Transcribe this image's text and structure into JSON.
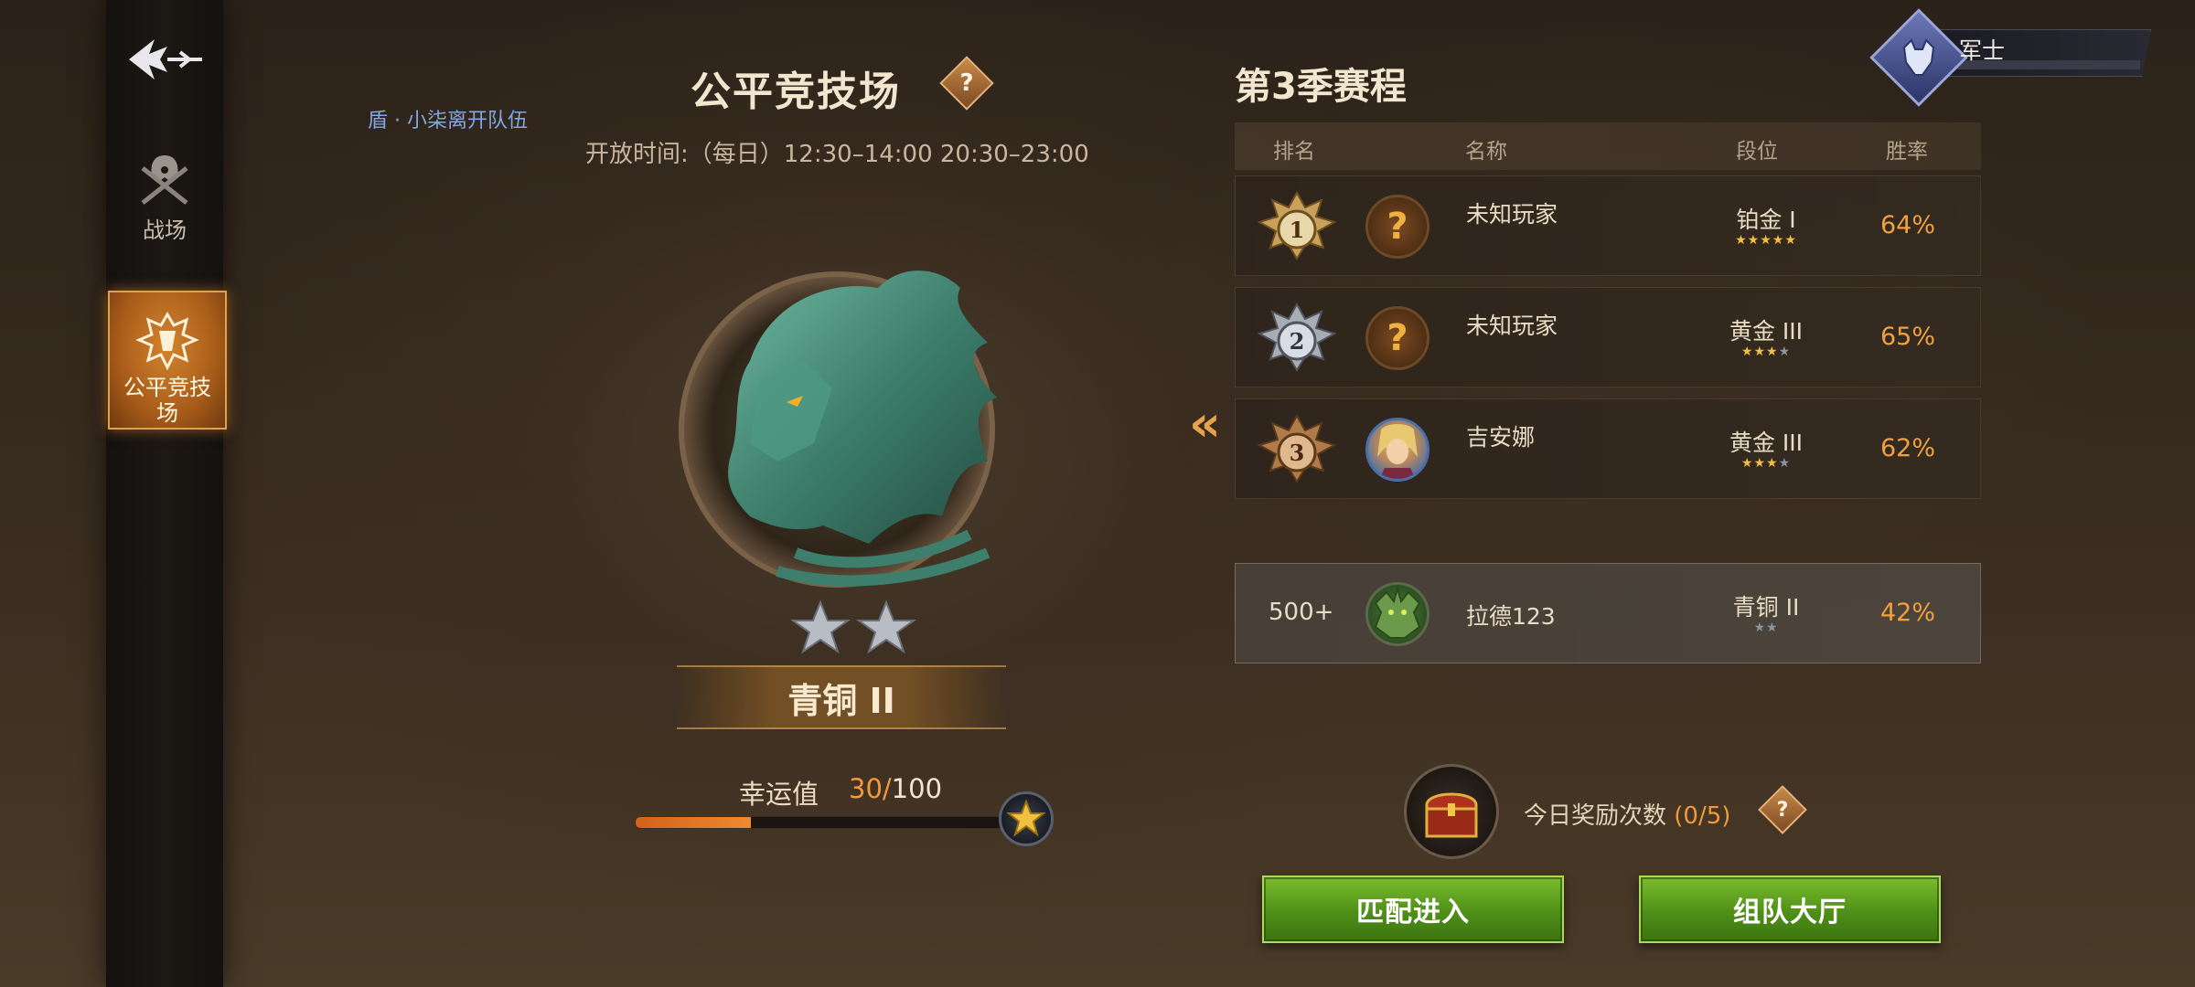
{
  "sidebar": {
    "items": [
      {
        "label": "战场",
        "icon": "crossed-swords-helmet-icon"
      },
      {
        "label": "公平竞技场",
        "icon": "arena-emblem-icon",
        "active": true
      }
    ]
  },
  "team_notice": "盾 · 小柒离开队伍",
  "arena": {
    "title": "公平竞技场",
    "open_time": "开放时间:（每日）12:30–14:00 20:30–23:00",
    "rank_name": "青铜 II",
    "stars": 2,
    "luck_label": "幸运值",
    "luck_current": "30/",
    "luck_max": "100",
    "luck_fraction": 0.3
  },
  "season": {
    "title": "第3季赛程",
    "headers": {
      "rank": "排名",
      "name": "名称",
      "tier": "段位",
      "winrate": "胜率"
    },
    "rows": [
      {
        "rank": "1",
        "name": "未知玩家",
        "tier": "铂金 I",
        "stars_on": 5,
        "stars_total": 5,
        "winrate": "64%"
      },
      {
        "rank": "2",
        "name": "未知玩家",
        "tier": "黄金 III",
        "stars_on": 3,
        "stars_total": 4,
        "winrate": "65%"
      },
      {
        "rank": "3",
        "name": "吉安娜",
        "tier": "黄金 III",
        "stars_on": 3,
        "stars_total": 4,
        "winrate": "62%"
      }
    ],
    "me": {
      "rank": "500+",
      "name": "拉德123",
      "tier": "青铜 II",
      "stars_on": 0,
      "stars_total": 2,
      "winrate": "42%"
    }
  },
  "reward": {
    "label": "今日奖励次数 ",
    "count": "(0/5)"
  },
  "buttons": {
    "match": "匹配进入",
    "team_hall": "组队大厅"
  },
  "player_rank": {
    "title": "军士"
  },
  "colors": {
    "accent": "#f09a3c",
    "button_green": "#5a9e1e",
    "link_blue": "#7fa8e8"
  }
}
